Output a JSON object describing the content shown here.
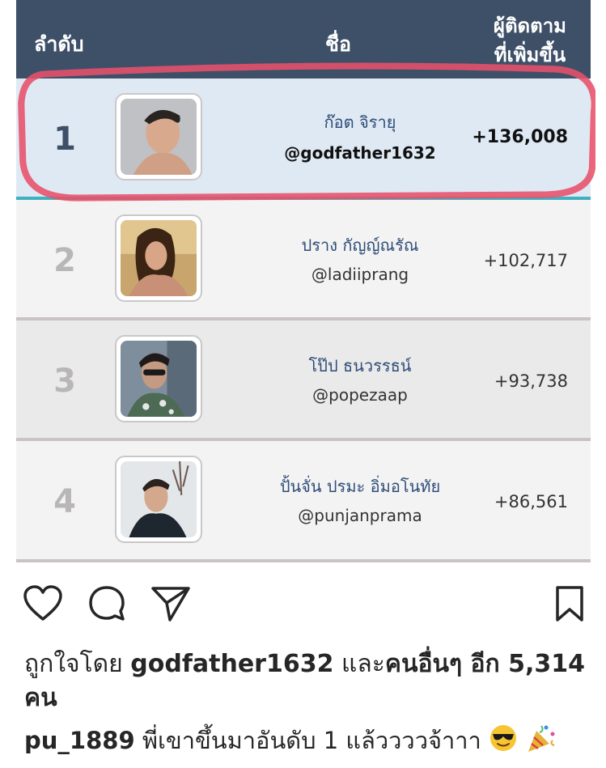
{
  "table": {
    "headers": {
      "rank": "ลำดับ",
      "name": "ชื่อ",
      "gain_line1": "ผู้ติดตาม",
      "gain_line2": "ที่เพิ่มขึ้น"
    },
    "rows": [
      {
        "rank": "1",
        "name": "ก๊อต จิรายุ",
        "handle": "@godfather1632",
        "gain": "+136,008",
        "highlighted": true
      },
      {
        "rank": "2",
        "name": "ปราง กัญญ์ณรัณ",
        "handle": "@ladiiprang",
        "gain": "+102,717"
      },
      {
        "rank": "3",
        "name": "โป๊ป ธนวรรธน์",
        "handle": "@popezaap",
        "gain": "+93,738"
      },
      {
        "rank": "4",
        "name": "ปั้นจั่น ปรมะ อิ่มอโนทัย",
        "handle": "@punjanprama",
        "gain": "+86,561"
      }
    ]
  },
  "post": {
    "icons": [
      "heart-icon",
      "comment-icon",
      "share-icon",
      "bookmark-icon"
    ],
    "likes_prefix": "ถูกใจโดย",
    "likes_user": "godfather1632",
    "likes_and": "และ",
    "likes_others": "คนอื่นๆ อีก 5,314 คน",
    "caption_user": "pu_1889",
    "caption_text": "พี่เขาขึ้นมาอันดับ 1 แล้ววววจ้าาา"
  },
  "colors": {
    "header_bg": "#3e5068",
    "highlight_ring": "#e8506a",
    "accent_teal": "#3fb0bf"
  }
}
